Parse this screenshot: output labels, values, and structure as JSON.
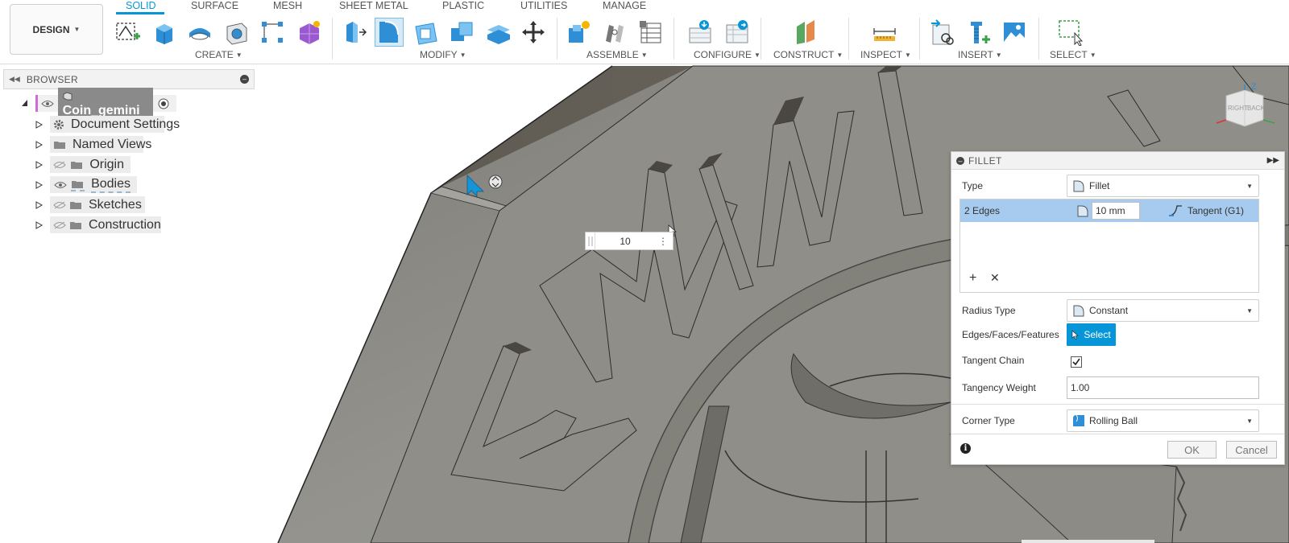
{
  "workspace": {
    "label": "DESIGN"
  },
  "tabs": [
    "SOLID",
    "SURFACE",
    "MESH",
    "SHEET METAL",
    "PLASTIC",
    "UTILITIES",
    "MANAGE"
  ],
  "active_tab": "SOLID",
  "groups": {
    "create": "CREATE",
    "modify": "MODIFY",
    "assemble": "ASSEMBLE",
    "configure": "CONFIGURE",
    "construct": "CONSTRUCT",
    "inspect": "INSPECT",
    "insert": "INSERT",
    "select": "SELECT"
  },
  "browser": {
    "title": "BROWSER",
    "root": "Coin_gemini",
    "items": [
      {
        "label": "Document Settings",
        "icon": "gear-icon"
      },
      {
        "label": "Named Views",
        "icon": "folder-icon"
      },
      {
        "label": "Origin",
        "icon": "folder-icon",
        "visibility": "hidden"
      },
      {
        "label": "Bodies",
        "icon": "folder-icon",
        "visibility": "visible"
      },
      {
        "label": "Sketches",
        "icon": "folder-icon",
        "visibility": "hidden"
      },
      {
        "label": "Construction",
        "icon": "folder-icon",
        "visibility": "hidden"
      }
    ]
  },
  "manipulator": {
    "value": "10"
  },
  "viewcube": {
    "right": "RIGHT",
    "back": "BACK",
    "z": "Z"
  },
  "fillet": {
    "title": "FILLET",
    "type_label": "Type",
    "type_value": "Fillet",
    "selection": {
      "edges": "2 Edges",
      "radius": "10 mm",
      "continuity": "Tangent (G1)"
    },
    "radius_type_label": "Radius Type",
    "radius_type_value": "Constant",
    "edges_label": "Edges/Faces/Features",
    "select_button": "Select",
    "tangent_chain_label": "Tangent Chain",
    "tangent_chain_checked": true,
    "tangency_weight_label": "Tangency Weight",
    "tangency_weight_value": "1.00",
    "corner_type_label": "Corner Type",
    "corner_type_value": "Rolling Ball",
    "ok": "OK",
    "cancel": "Cancel"
  },
  "colors": {
    "accent": "#0696d7",
    "selection_row": "#a7cbef",
    "model_face": "#8b8b85",
    "model_side": "#6a665e"
  }
}
